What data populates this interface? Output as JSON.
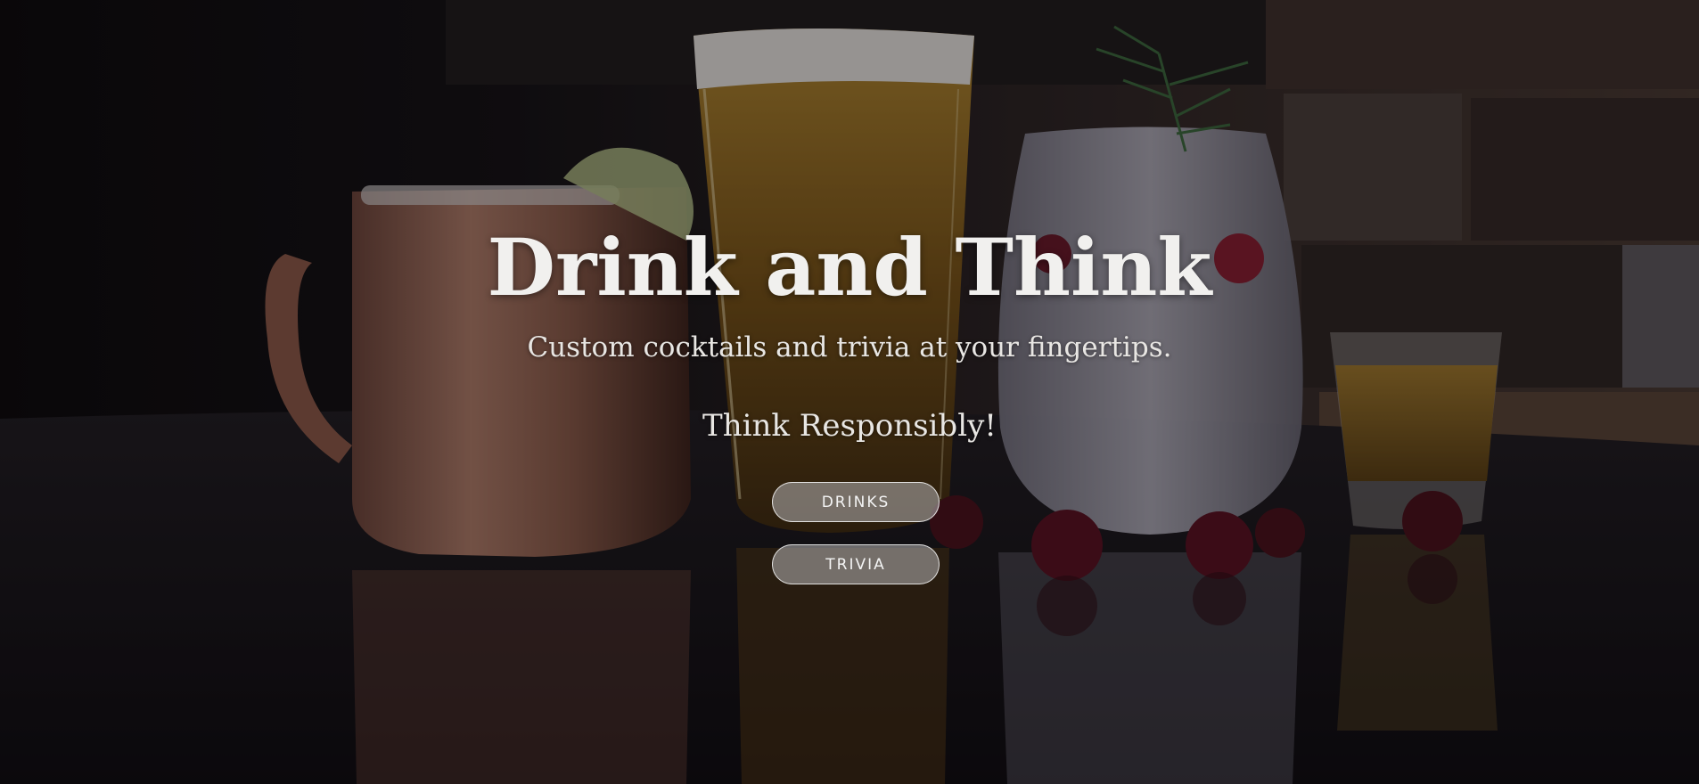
{
  "hero": {
    "title": "Drink and Think",
    "subtitle": "Custom cocktails and trivia at your fingertips.",
    "tagline": "Think Responsibly!"
  },
  "buttons": {
    "drinks_label": "DRINKS",
    "trivia_label": "TRIVIA"
  },
  "background": {
    "description_icon": "drinks-photo",
    "overlay_color": "#0a080c"
  }
}
